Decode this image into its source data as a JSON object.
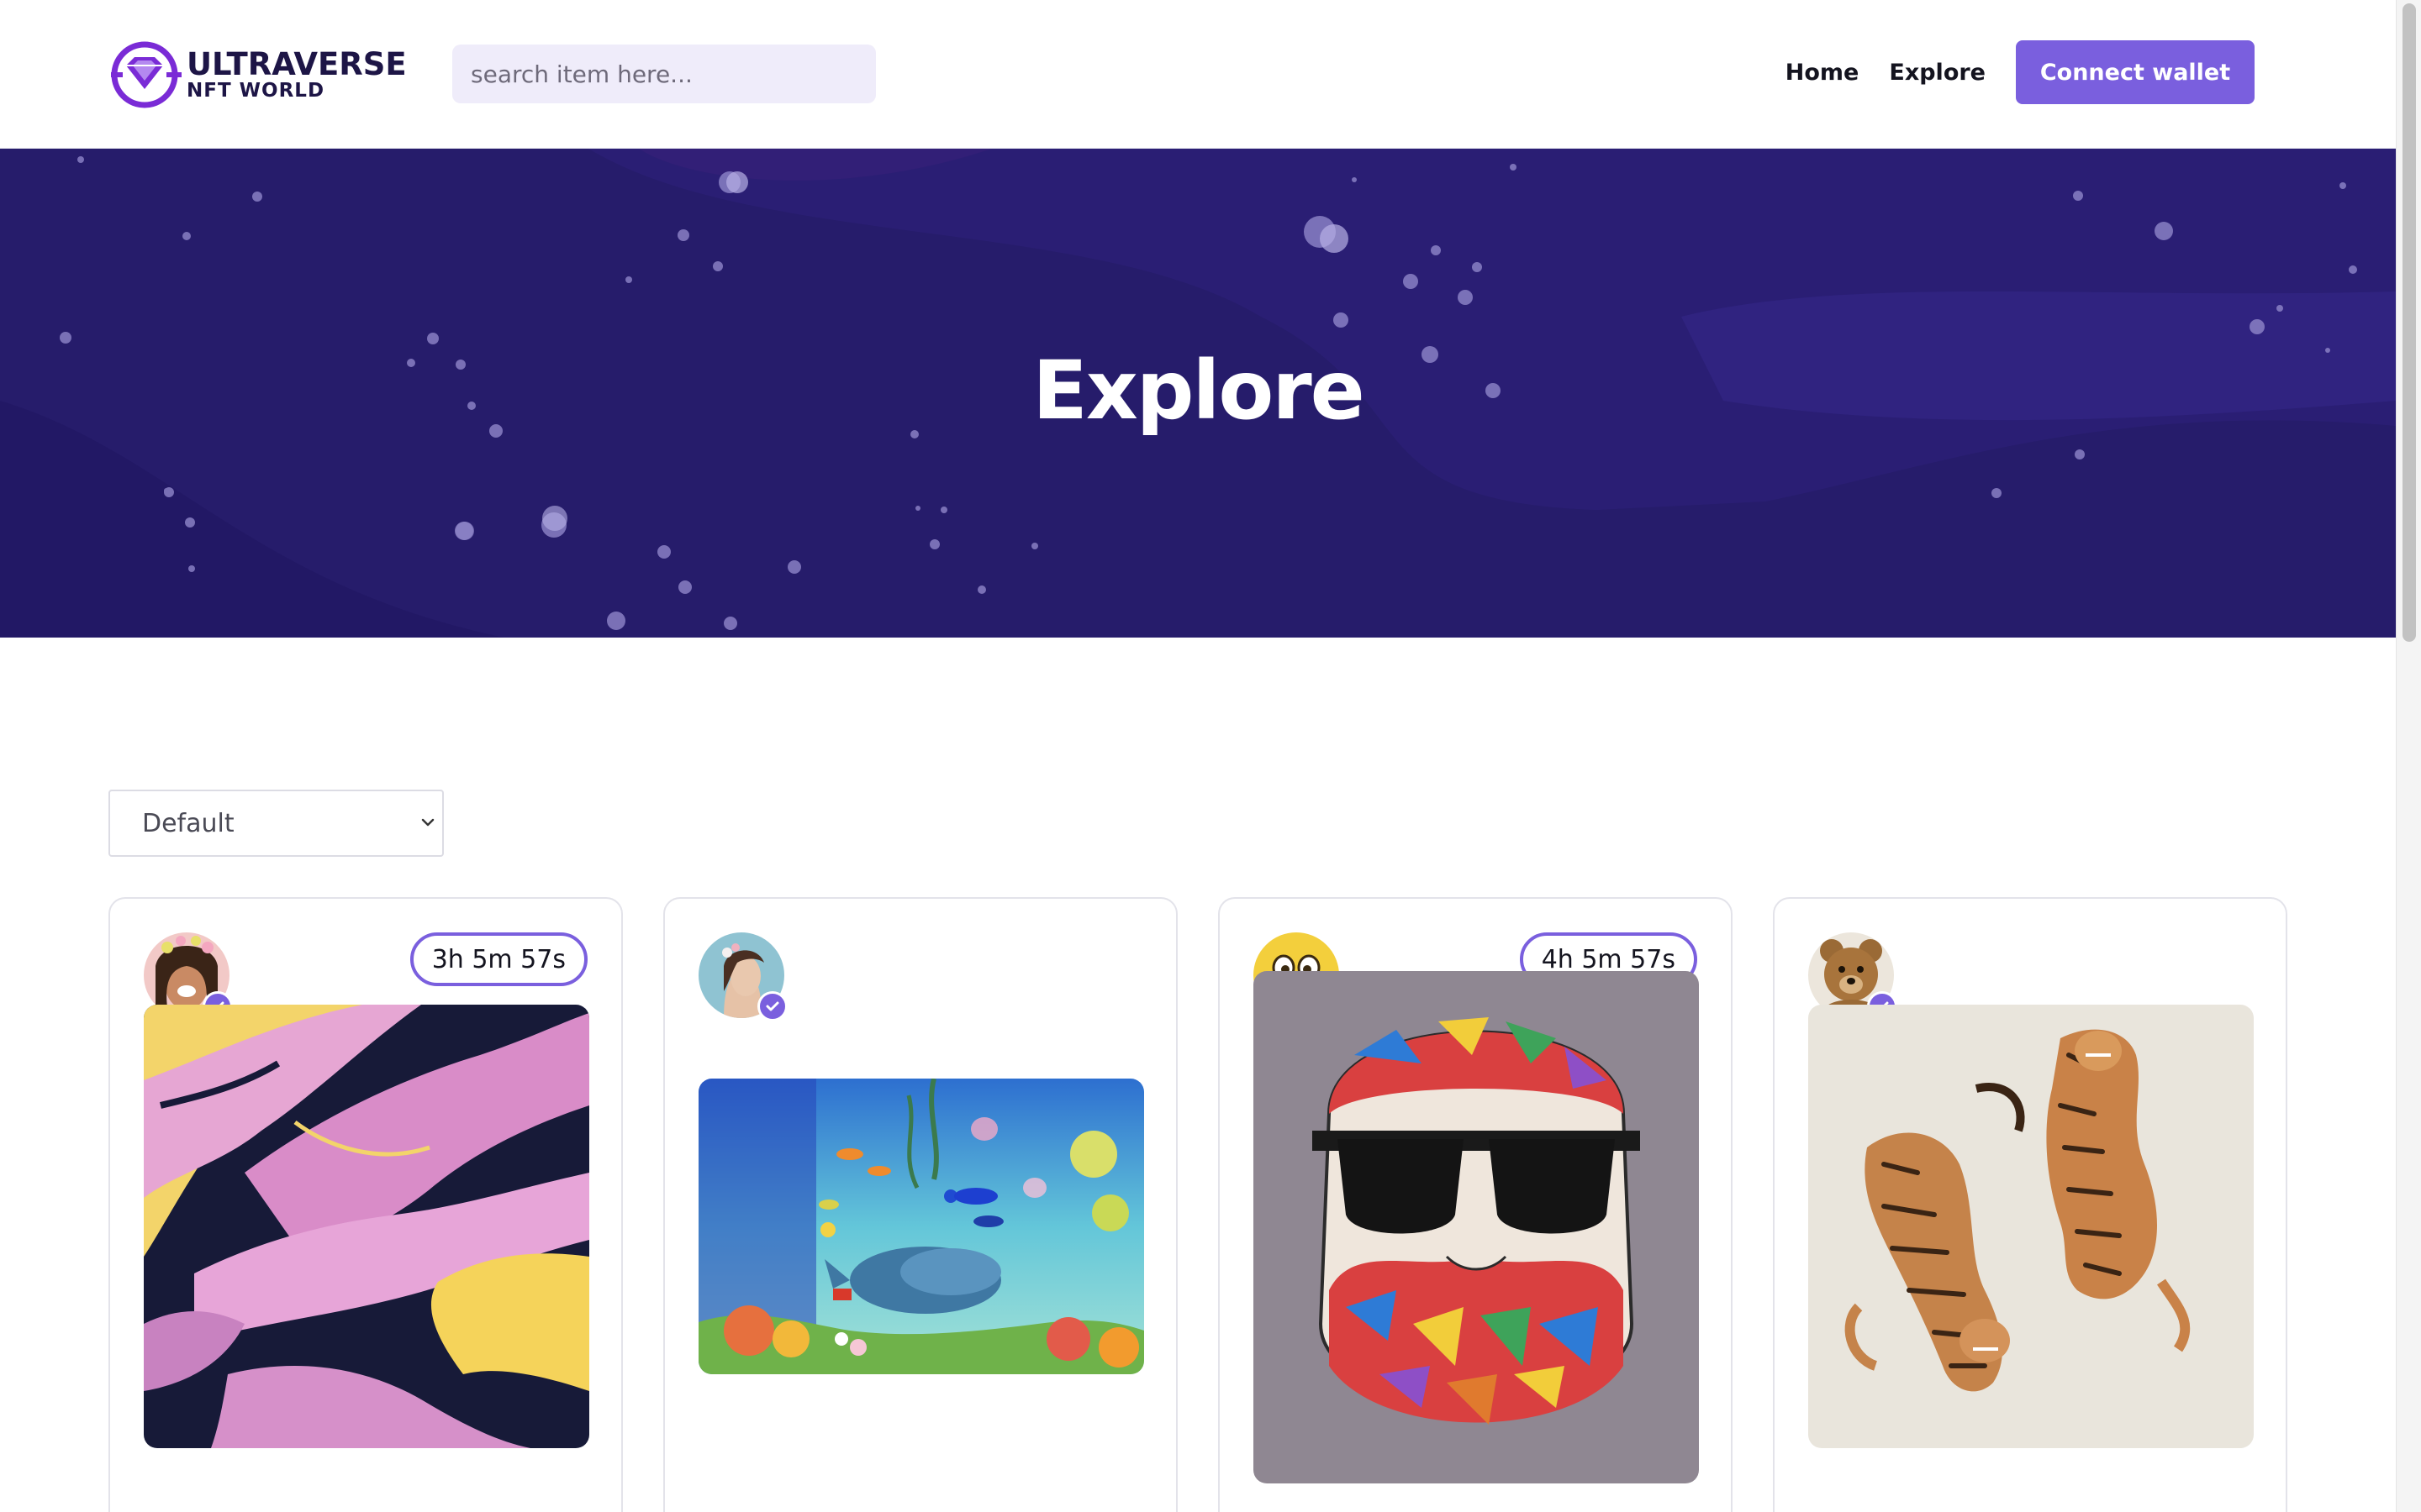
{
  "header": {
    "logo_line1": "ULTRAVERSE",
    "logo_line2": "NFT WORLD",
    "search_placeholder": "search item here...",
    "nav": [
      "Home",
      "Explore"
    ],
    "connect_label": "Connect wallet"
  },
  "hero": {
    "title": "Explore"
  },
  "sort": {
    "selected": "Default"
  },
  "cards": [
    {
      "avatar": "woman-with-flower-crown-avatar",
      "timer": "3h 5m 57s",
      "artwork": "pink-yellow-marble-fluid-art"
    },
    {
      "avatar": "woman-with-flowers-avatar",
      "timer": "",
      "artwork": "underwater-whale-coral-scene"
    },
    {
      "avatar": "smiley-face-avatar",
      "timer": "4h 5m 57s",
      "artwork": "mosaic-beard-man-sunglasses"
    },
    {
      "avatar": "teddy-bear-avatar",
      "timer": "",
      "artwork": "two-tigers-illustration"
    }
  ],
  "colors": {
    "accent": "#7a5fde",
    "hero_bg": "#261c6b",
    "brand_dark": "#1d1546"
  }
}
